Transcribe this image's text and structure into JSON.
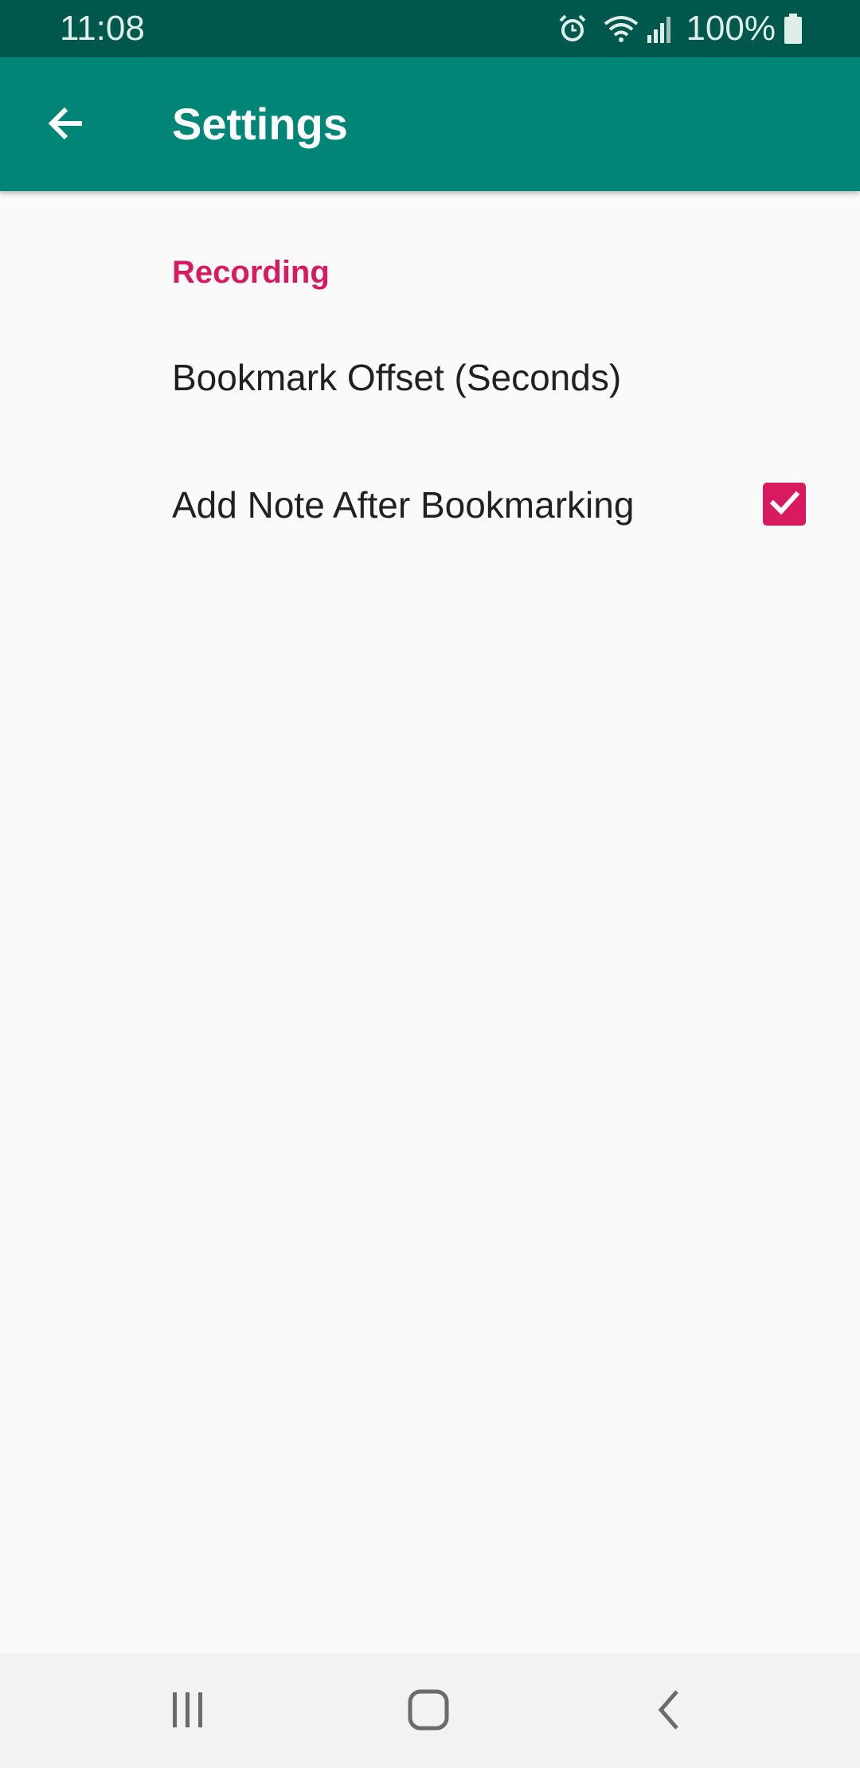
{
  "status_bar": {
    "time": "11:08",
    "battery_text": "100%",
    "icons": [
      "alarm-icon",
      "wifi-icon",
      "signal-icon",
      "battery-icon"
    ]
  },
  "app_bar": {
    "title": "Settings",
    "back_icon": "arrow-back-icon",
    "background_color": "#008577"
  },
  "settings": {
    "category_title": "Recording",
    "accent_color": "#d81b60",
    "items": [
      {
        "title": "Bookmark Offset (Seconds)"
      },
      {
        "title": "Add Note After Bookmarking",
        "checked": true
      }
    ]
  },
  "nav_bar": {
    "buttons": [
      "recents-icon",
      "home-icon",
      "back-icon"
    ]
  }
}
